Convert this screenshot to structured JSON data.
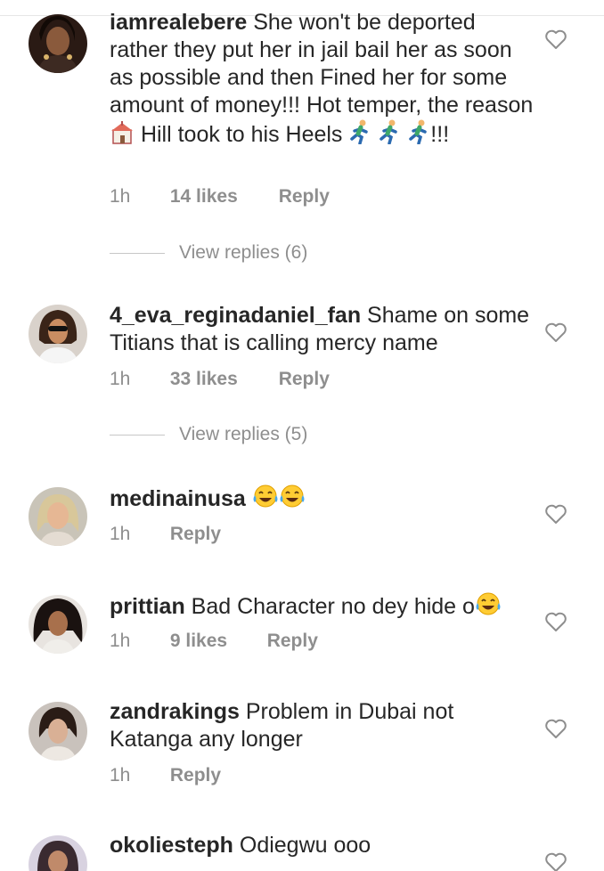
{
  "comments": [
    {
      "username": "iamrealebere",
      "text": "She won't be deported rather they put her in jail bail her as soon as possible and then Fined her for some amount of money!!! Hot temper, the reason",
      "text_after": "Hill took to his Heels",
      "text_end": "!!!",
      "time": "1h",
      "likes": "14 likes",
      "reply": "Reply",
      "view_replies": "View replies (6)"
    },
    {
      "username": "4_eva_reginadaniel_fan",
      "text": "Shame on some Titians that is calling mercy name",
      "time": "1h",
      "likes": "33 likes",
      "reply": "Reply",
      "view_replies": "View replies (5)"
    },
    {
      "username": "medinainusa",
      "text": "",
      "time": "1h",
      "reply": "Reply"
    },
    {
      "username": "prittian",
      "text": "Bad Character no dey hide o",
      "time": "1h",
      "likes": "9 likes",
      "reply": "Reply"
    },
    {
      "username": "zandrakings",
      "text": "Problem in Dubai not Katanga any longer",
      "time": "1h",
      "reply": "Reply"
    },
    {
      "username": "okoliesteph",
      "text": "Odiegwu ooo"
    }
  ],
  "icons": {
    "heart": "heart-outline-icon",
    "laugh": "face-with-tears-of-joy-emoji",
    "runner": "person-running-emoji",
    "church": "church-emoji"
  },
  "colors": {
    "text": "#262626",
    "meta": "#8e8e8e",
    "divider": "#c7c7c7"
  }
}
